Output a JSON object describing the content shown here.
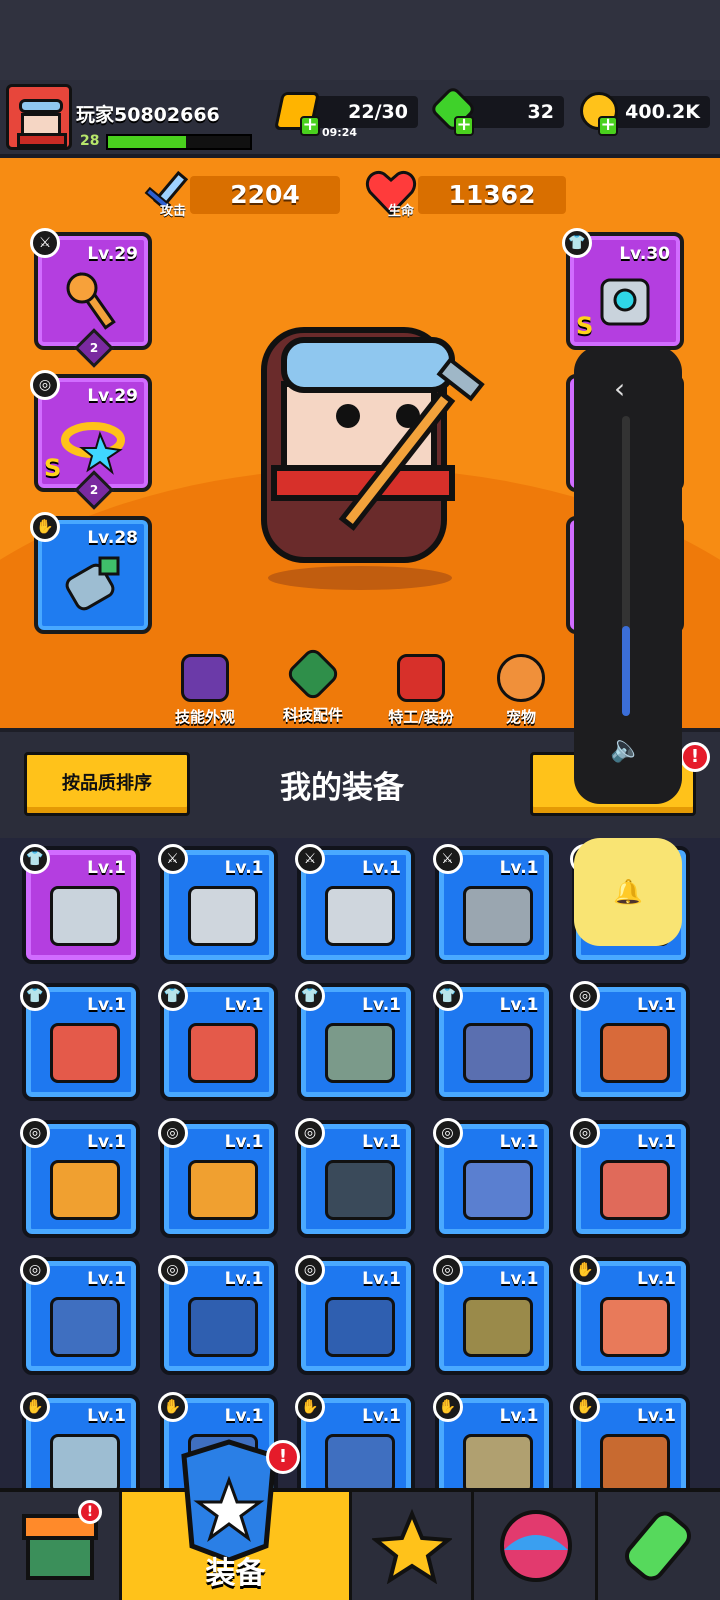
{
  "player": {
    "name": "玩家50802666",
    "level": "28",
    "xp_fraction": 0.55
  },
  "resources": {
    "energy": "22/30",
    "energy_timer": "09:24",
    "gems": "32",
    "coins": "400.2K"
  },
  "stats": {
    "attack_label": "攻击",
    "attack_value": "2204",
    "hp_label": "生命",
    "hp_value": "11362"
  },
  "equipped": {
    "weapon": {
      "level": "Lv.29",
      "stars": "2"
    },
    "ring": {
      "level": "Lv.29",
      "grade": "S",
      "stars": "2"
    },
    "glove": {
      "level": "Lv.28"
    },
    "armor": {
      "level": "Lv.30",
      "grade": "S"
    }
  },
  "shortcuts": [
    "技能外观",
    "科技配件",
    "特工/装扮",
    "宠物"
  ],
  "sort_button": "按品质排序",
  "inventory_title": "我的装备",
  "inventory": [
    "Lv.1",
    "Lv.1",
    "Lv.1",
    "Lv.1",
    "Lv.1",
    "Lv.1",
    "Lv.1",
    "Lv.1",
    "Lv.1",
    "Lv.1",
    "Lv.1",
    "Lv.1",
    "Lv.1",
    "Lv.1",
    "Lv.1",
    "Lv.1",
    "Lv.1",
    "Lv.1",
    "Lv.1",
    "Lv.1",
    "Lv.1",
    "Lv.1",
    "Lv.1",
    "Lv.1",
    "Lv.1"
  ],
  "badge_mark": "!",
  "volume_level": 0.3,
  "tabs": {
    "equip_label": "装备"
  },
  "colors": {
    "rare_blue": "#1e78f0",
    "epic_purple": "#b43ee0",
    "accent_yellow": "#ffc21a",
    "stage_orange": "#f78c13"
  }
}
